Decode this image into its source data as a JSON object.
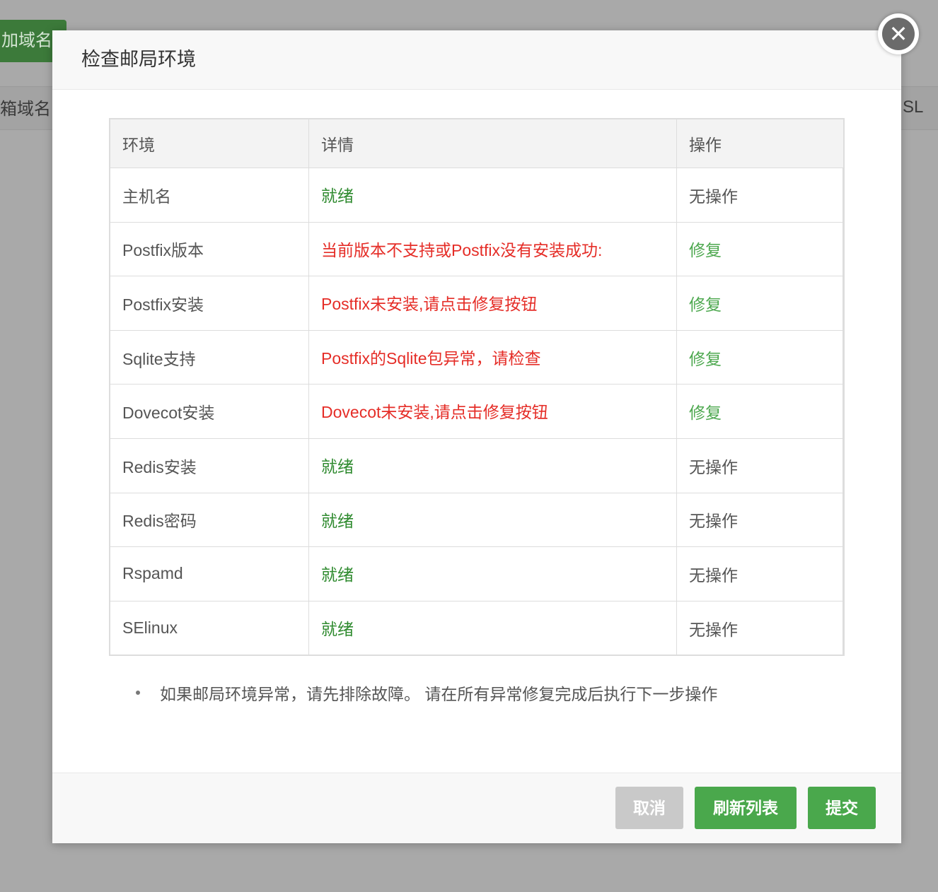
{
  "background": {
    "add_domain_label": "加域名",
    "col_left_label": "箱域名",
    "col_right_label": "SL"
  },
  "modal": {
    "title": "检查邮局环境",
    "close_icon": "close-icon",
    "table": {
      "headers": [
        "环境",
        "详情",
        "操作"
      ],
      "rows": [
        {
          "env": "主机名",
          "detail": "就绪",
          "detail_status": "ok",
          "action": "无操作",
          "action_type": "none"
        },
        {
          "env": "Postfix版本",
          "detail": "当前版本不支持或Postfix没有安装成功:",
          "detail_status": "error",
          "action": "修复",
          "action_type": "fix"
        },
        {
          "env": "Postfix安装",
          "detail": "Postfix未安装,请点击修复按钮",
          "detail_status": "error",
          "action": "修复",
          "action_type": "fix"
        },
        {
          "env": "Sqlite支持",
          "detail": "Postfix的Sqlite包异常，请检查",
          "detail_status": "error",
          "action": "修复",
          "action_type": "fix"
        },
        {
          "env": "Dovecot安装",
          "detail": "Dovecot未安装,请点击修复按钮",
          "detail_status": "error",
          "action": "修复",
          "action_type": "fix"
        },
        {
          "env": "Redis安装",
          "detail": "就绪",
          "detail_status": "ok",
          "action": "无操作",
          "action_type": "none"
        },
        {
          "env": "Redis密码",
          "detail": "就绪",
          "detail_status": "ok",
          "action": "无操作",
          "action_type": "none"
        },
        {
          "env": "Rspamd",
          "detail": "就绪",
          "detail_status": "ok",
          "action": "无操作",
          "action_type": "none"
        },
        {
          "env": "SElinux",
          "detail": "就绪",
          "detail_status": "ok",
          "action": "无操作",
          "action_type": "none"
        }
      ]
    },
    "note": "如果邮局环境异常，请先排除故障。 请在所有异常修复完成后执行下一步操作",
    "footer": {
      "cancel_label": "取消",
      "refresh_label": "刷新列表",
      "submit_label": "提交"
    }
  },
  "colors": {
    "ok": "#2e8a2e",
    "error": "#e52d27",
    "fix": "#4da84f",
    "primary_button": "#4aa84c",
    "disabled_button": "#c9c9c9"
  }
}
